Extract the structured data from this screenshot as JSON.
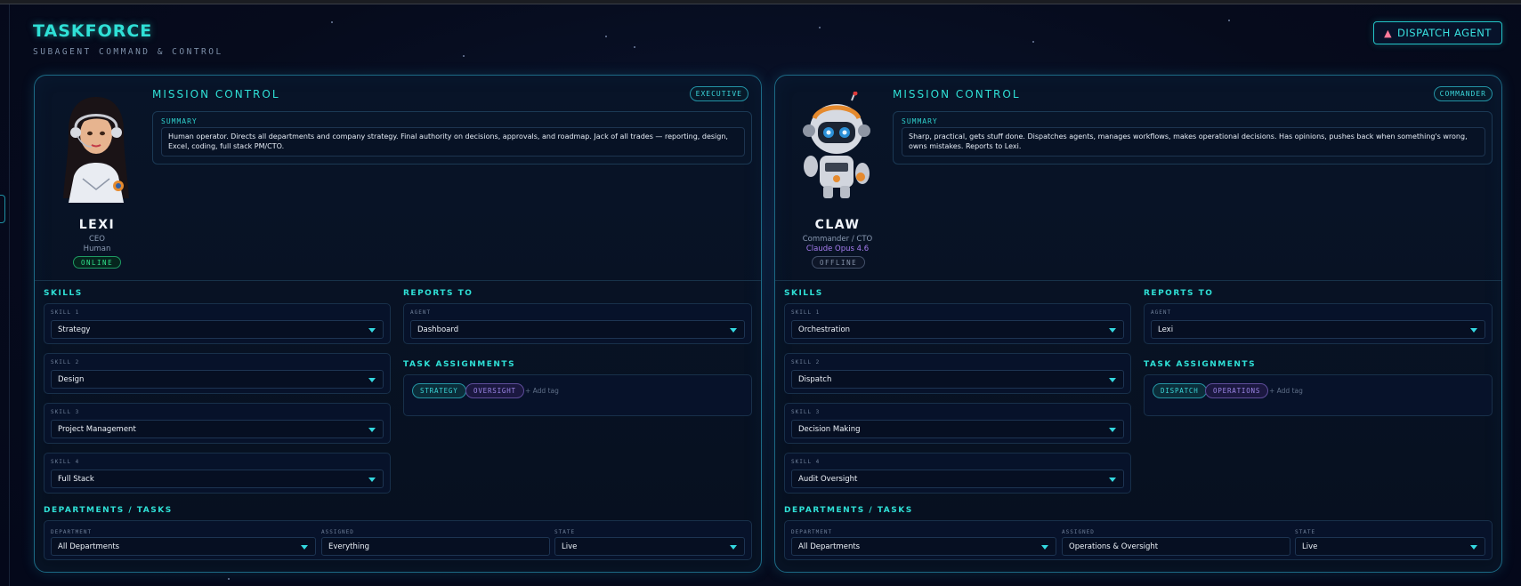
{
  "app": {
    "title": "TASKFORCE",
    "subtitle": "SUBAGENT COMMAND & CONTROL",
    "dispatch_label": "DISPATCH AGENT",
    "dispatch_icon": "rocket-icon"
  },
  "labels": {
    "mission_control": "MISSION CONTROL",
    "summary": "SUMMARY",
    "skills": "SKILLS",
    "reports_to": "REPORTS TO",
    "agent": "AGENT",
    "task_assignments": "TASK ASSIGNMENTS",
    "departments_tasks": "DEPARTMENTS / TASKS",
    "department": "DEPARTMENT",
    "assigned": "ASSIGNED",
    "state": "STATE",
    "add_tag": "+ Add tag",
    "skill_labels": [
      "SKILL 1",
      "SKILL 2",
      "SKILL 3",
      "SKILL 4"
    ]
  },
  "colors": {
    "accent": "#2fe0d6",
    "online": "#2fe08a",
    "offline": "#8391a8",
    "model": "#a67cf0",
    "tag_purple": "#9c86e6"
  },
  "agents": [
    {
      "name": "LEXI",
      "role": "CEO",
      "type": "Human",
      "status": "ONLINE",
      "badge": "EXECUTIVE",
      "summary": "Human operator. Directs all departments and company strategy. Final authority on decisions, approvals, and roadmap. Jack of all trades — reporting, design, Excel, coding, full stack PM/CTO.",
      "skills": [
        "Strategy",
        "Design",
        "Project Management",
        "Full Stack"
      ],
      "reports_to": "Dashboard",
      "tags": [
        "STRATEGY",
        "OVERSIGHT"
      ],
      "department": "All Departments",
      "assigned": "Everything",
      "state": "Live"
    },
    {
      "name": "CLAW",
      "role": "Commander / CTO",
      "type": "Claude Opus 4.6",
      "status": "OFFLINE",
      "badge": "COMMANDER",
      "summary": "Sharp, practical, gets stuff done. Dispatches agents, manages workflows, makes operational decisions. Has opinions, pushes back when something's wrong, owns mistakes. Reports to Lexi.",
      "skills": [
        "Orchestration",
        "Dispatch",
        "Decision Making",
        "Audit Oversight"
      ],
      "reports_to": "Lexi",
      "tags": [
        "DISPATCH",
        "OPERATIONS"
      ],
      "department": "All Departments",
      "assigned": "Operations & Oversight",
      "state": "Live"
    }
  ]
}
